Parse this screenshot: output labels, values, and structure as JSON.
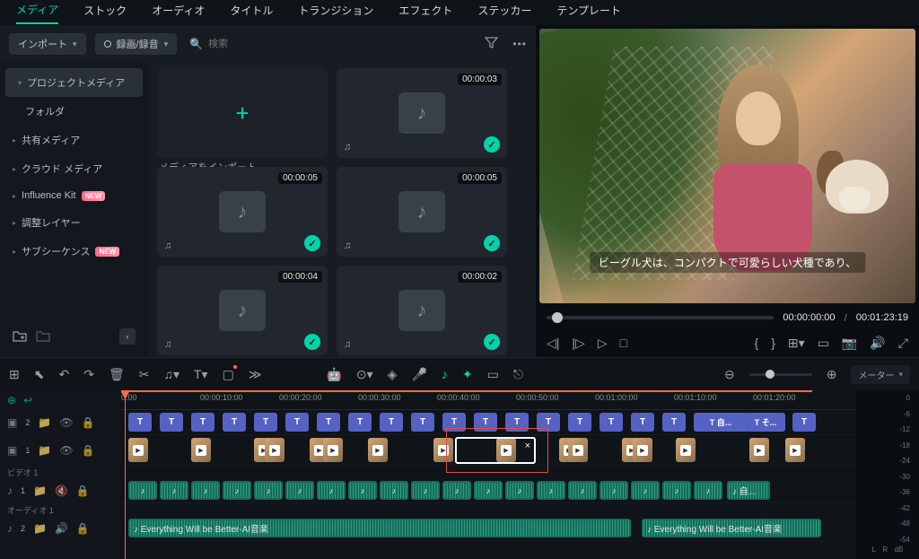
{
  "tabs": [
    "メディア",
    "ストック",
    "オーディオ",
    "タイトル",
    "トランジション",
    "エフェクト",
    "ステッカー",
    "テンプレート"
  ],
  "toolbar": {
    "import": "インポート",
    "record": "録画/録音",
    "search_ph": "検索"
  },
  "sidebar": {
    "items": [
      {
        "label": "プロジェクトメディア",
        "sel": true
      },
      {
        "label": "フォルダ"
      },
      {
        "label": "共有メディア",
        "caret": true
      },
      {
        "label": "クラウド メディア",
        "caret": true
      },
      {
        "label": "Influence Kit",
        "caret": true,
        "badge": "NEW"
      },
      {
        "label": "調整レイヤー",
        "caret": true
      },
      {
        "label": "サブシーケンス",
        "caret": true,
        "badge": "NEW"
      }
    ]
  },
  "import_label": "メディアをインポート",
  "clips": [
    {
      "dur": "00:00:03"
    },
    {
      "dur": "00:00:05"
    },
    {
      "dur": "00:00:05"
    },
    {
      "dur": "00:00:04"
    },
    {
      "dur": "00:00:02"
    }
  ],
  "preview": {
    "subtitle": "ビーグル犬は、コンパクトで可愛らしい犬種であり、",
    "tc_cur": "00:00:00:00",
    "tc_dur": "00:01:23:19"
  },
  "ruler": [
    "0:00",
    "00:00:10:00",
    "00:00:20:00",
    "00:00:30:00",
    "00:00:40:00",
    "00:00:50:00",
    "00:01:00:00",
    "00:01:10:00",
    "00:01:20:00"
  ],
  "txt_clips_labeled": [
    "T 自...",
    "T そ..."
  ],
  "aud_label_a": "自...",
  "music": "Everything Will be Better-AI音楽",
  "meter_dd": "メーター",
  "meter_ticks": [
    "0",
    "-6",
    "-12",
    "-18",
    "-24",
    "-30",
    "-36",
    "-42",
    "-48",
    "-54"
  ],
  "meter_unit": "dB",
  "track_labels": {
    "vid": "ビデオ 1",
    "aud": "オーディオ 1"
  },
  "lr": {
    "L": "L",
    "R": "R"
  }
}
